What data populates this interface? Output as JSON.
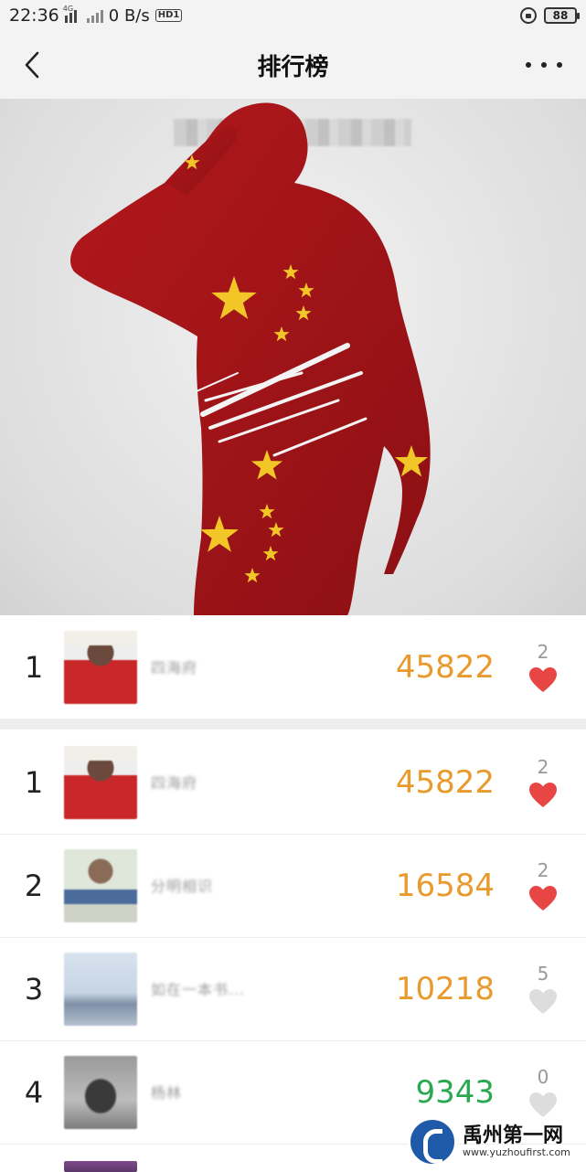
{
  "status_bar": {
    "time": "22:36",
    "net_speed": "0 B/s",
    "sim1_label": "4G",
    "hd_label": "HD1",
    "battery": "88"
  },
  "nav": {
    "title": "排行榜"
  },
  "banner": {
    "image": "soldier-salute-silhouette-with-chinese-flag-pattern"
  },
  "colors": {
    "score_high": "#e99a2c",
    "score_low": "#2aa84f",
    "heart_liked": "#e84545",
    "heart_unliked": "#dddddd"
  },
  "my_rank": {
    "rank": "1",
    "name": "四海府",
    "score": "45822",
    "likes": "2",
    "liked": true
  },
  "ranking": [
    {
      "rank": "1",
      "name": "四海府",
      "score": "45822",
      "likes": "2",
      "liked": true,
      "score_color": "orange"
    },
    {
      "rank": "2",
      "name": "分明相识",
      "score": "16584",
      "likes": "2",
      "liked": true,
      "score_color": "orange"
    },
    {
      "rank": "3",
      "name": "如在一本书...",
      "score": "10218",
      "likes": "5",
      "liked": false,
      "score_color": "orange"
    },
    {
      "rank": "4",
      "name": "杨林",
      "score": "9343",
      "likes": "0",
      "liked": false,
      "score_color": "green"
    }
  ],
  "watermark": {
    "name": "禹州第一网",
    "url": "www.yuzhoufirst.com"
  }
}
